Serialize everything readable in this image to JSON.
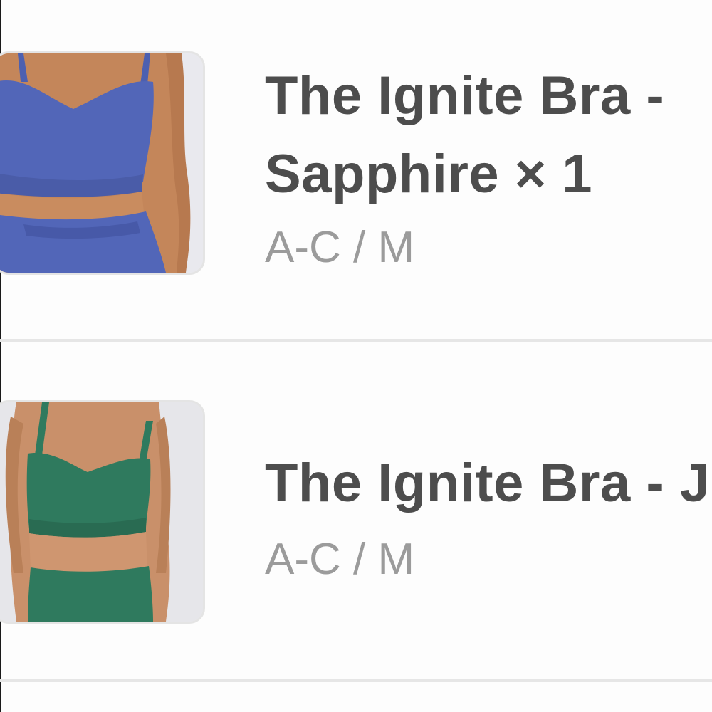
{
  "cart": {
    "items": [
      {
        "title_line1": "The Ignite Bra -",
        "title_line2": "Sapphire × 1",
        "variant": "A-C / M",
        "image_icon": "sapphire-sports-bra-photo",
        "color": "#5266b8"
      },
      {
        "title_line1": "The Ignite Bra - J",
        "variant": "A-C / M",
        "image_icon": "green-sports-bra-photo",
        "color": "#2f7a5e"
      }
    ]
  }
}
